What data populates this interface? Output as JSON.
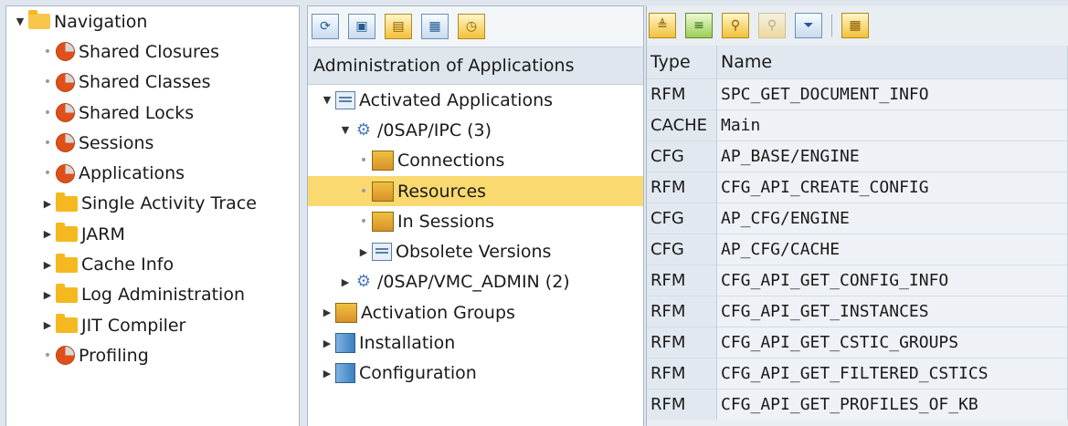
{
  "left_tree": {
    "root": "Navigation",
    "items": [
      {
        "label": "Shared Closures",
        "icon": "pie-icon",
        "kind": "leaf"
      },
      {
        "label": "Shared Classes",
        "icon": "pie-icon",
        "kind": "leaf"
      },
      {
        "label": "Shared Locks",
        "icon": "pie-icon",
        "kind": "leaf"
      },
      {
        "label": "Sessions",
        "icon": "pie-icon",
        "kind": "leaf"
      },
      {
        "label": "Applications",
        "icon": "pie-icon",
        "kind": "leaf"
      },
      {
        "label": "Single Activity Trace",
        "icon": "folder-icon",
        "kind": "folder"
      },
      {
        "label": "JARM",
        "icon": "folder-icon",
        "kind": "folder"
      },
      {
        "label": "Cache Info",
        "icon": "folder-icon",
        "kind": "folder"
      },
      {
        "label": "Log Administration",
        "icon": "folder-icon",
        "kind": "folder"
      },
      {
        "label": "JIT Compiler",
        "icon": "folder-icon",
        "kind": "folder"
      },
      {
        "label": "Profiling",
        "icon": "pie-icon",
        "kind": "leaf"
      }
    ]
  },
  "middle": {
    "header": "Administration of Applications",
    "tree": {
      "activated_applications": "Activated Applications",
      "app1": "/0SAP/IPC (3)",
      "connections": "Connections",
      "resources": "Resources",
      "in_sessions": "In Sessions",
      "obsolete_versions": "Obsolete Versions",
      "app2": "/0SAP/VMC_ADMIN (2)",
      "activation_groups": "Activation Groups",
      "installation": "Installation",
      "configuration": "Configuration"
    }
  },
  "right": {
    "columns": {
      "type": "Type",
      "name": "Name"
    },
    "rows": [
      {
        "type": "RFM",
        "name": "SPC_GET_DOCUMENT_INFO"
      },
      {
        "type": "CACHE",
        "name": "Main"
      },
      {
        "type": "CFG",
        "name": "AP_BASE/ENGINE"
      },
      {
        "type": "RFM",
        "name": "CFG_API_CREATE_CONFIG"
      },
      {
        "type": "CFG",
        "name": "AP_CFG/ENGINE"
      },
      {
        "type": "CFG",
        "name": "AP_CFG/CACHE"
      },
      {
        "type": "RFM",
        "name": "CFG_API_GET_CONFIG_INFO"
      },
      {
        "type": "RFM",
        "name": "CFG_API_GET_INSTANCES"
      },
      {
        "type": "RFM",
        "name": "CFG_API_GET_CSTIC_GROUPS"
      },
      {
        "type": "RFM",
        "name": "CFG_API_GET_FILTERED_CSTICS"
      },
      {
        "type": "RFM",
        "name": "CFG_API_GET_PROFILES_OF_KB"
      }
    ]
  },
  "colors": {
    "selected": "#fbd971",
    "folder": "#f5b821",
    "pie": "#e0501b"
  }
}
